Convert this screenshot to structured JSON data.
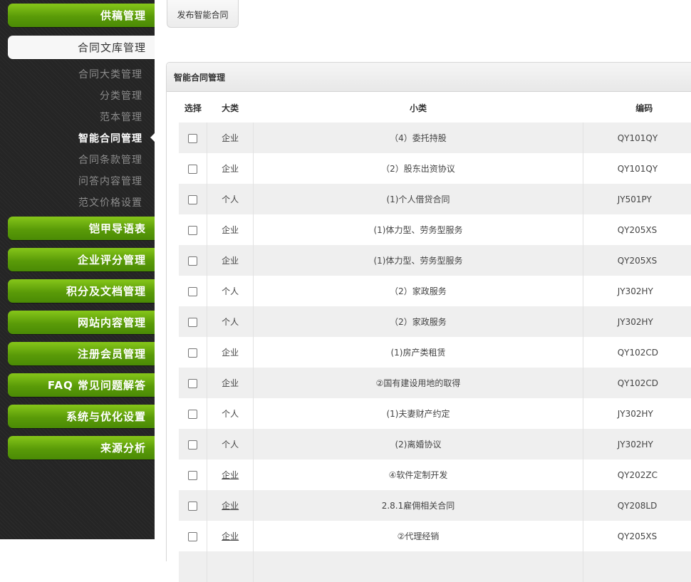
{
  "sidebar": {
    "top_item": "供稿管理",
    "active_section": "合同文库管理",
    "sub_items": [
      {
        "label": "合同大类管理",
        "current": false
      },
      {
        "label": "分类管理",
        "current": false
      },
      {
        "label": "范本管理",
        "current": false
      },
      {
        "label": "智能合同管理",
        "current": true
      },
      {
        "label": "合同条款管理",
        "current": false
      },
      {
        "label": "问答内容管理",
        "current": false
      },
      {
        "label": "范文价格设置",
        "current": false
      }
    ],
    "items": [
      "铠甲导语表",
      "企业评分管理",
      "积分及文档管理",
      "网站内容管理",
      "注册会员管理",
      "FAQ 常见问题解答",
      "系统与优化设置",
      "来源分析"
    ]
  },
  "toolbar": {
    "publish_label": "发布智能合同"
  },
  "panel": {
    "title": "智能合同管理",
    "columns": [
      "选择",
      "大类",
      "小类",
      "编码"
    ],
    "rows": [
      {
        "category": "企业",
        "subcategory": "（4）委托持股",
        "code": "QY101QY",
        "link": false
      },
      {
        "category": "企业",
        "subcategory": "（2）股东出资协议",
        "code": "QY101QY",
        "link": false
      },
      {
        "category": "个人",
        "subcategory": "(1)个人借贷合同",
        "code": "JY501PY",
        "link": false
      },
      {
        "category": "企业",
        "subcategory": "(1)体力型、劳务型服务",
        "code": "QY205XS",
        "link": false
      },
      {
        "category": "企业",
        "subcategory": "(1)体力型、劳务型服务",
        "code": "QY205XS",
        "link": false
      },
      {
        "category": "个人",
        "subcategory": "（2）家政服务",
        "code": "JY302HY",
        "link": false
      },
      {
        "category": "个人",
        "subcategory": "（2）家政服务",
        "code": "JY302HY",
        "link": false
      },
      {
        "category": "企业",
        "subcategory": "(1)房产类租赁",
        "code": "QY102CD",
        "link": false
      },
      {
        "category": "企业",
        "subcategory": "②国有建设用地的取得",
        "code": "QY102CD",
        "link": false
      },
      {
        "category": "个人",
        "subcategory": "(1)夫妻财产约定",
        "code": "JY302HY",
        "link": false
      },
      {
        "category": "个人",
        "subcategory": "(2)离婚协议",
        "code": "JY302HY",
        "link": false
      },
      {
        "category": "企业",
        "subcategory": "④软件定制开发",
        "code": "QY202ZC",
        "link": true
      },
      {
        "category": "企业",
        "subcategory": "2.8.1雇佣相关合同",
        "code": "QY208LD",
        "link": true
      },
      {
        "category": "企业",
        "subcategory": "②代理经销",
        "code": "QY205XS",
        "link": true
      },
      {
        "category": "",
        "subcategory": "",
        "code": "",
        "link": false
      }
    ]
  },
  "colors": {
    "nav_green": "#5a9b08",
    "sidebar_bg": "#272727",
    "row_alt": "#efefef"
  }
}
